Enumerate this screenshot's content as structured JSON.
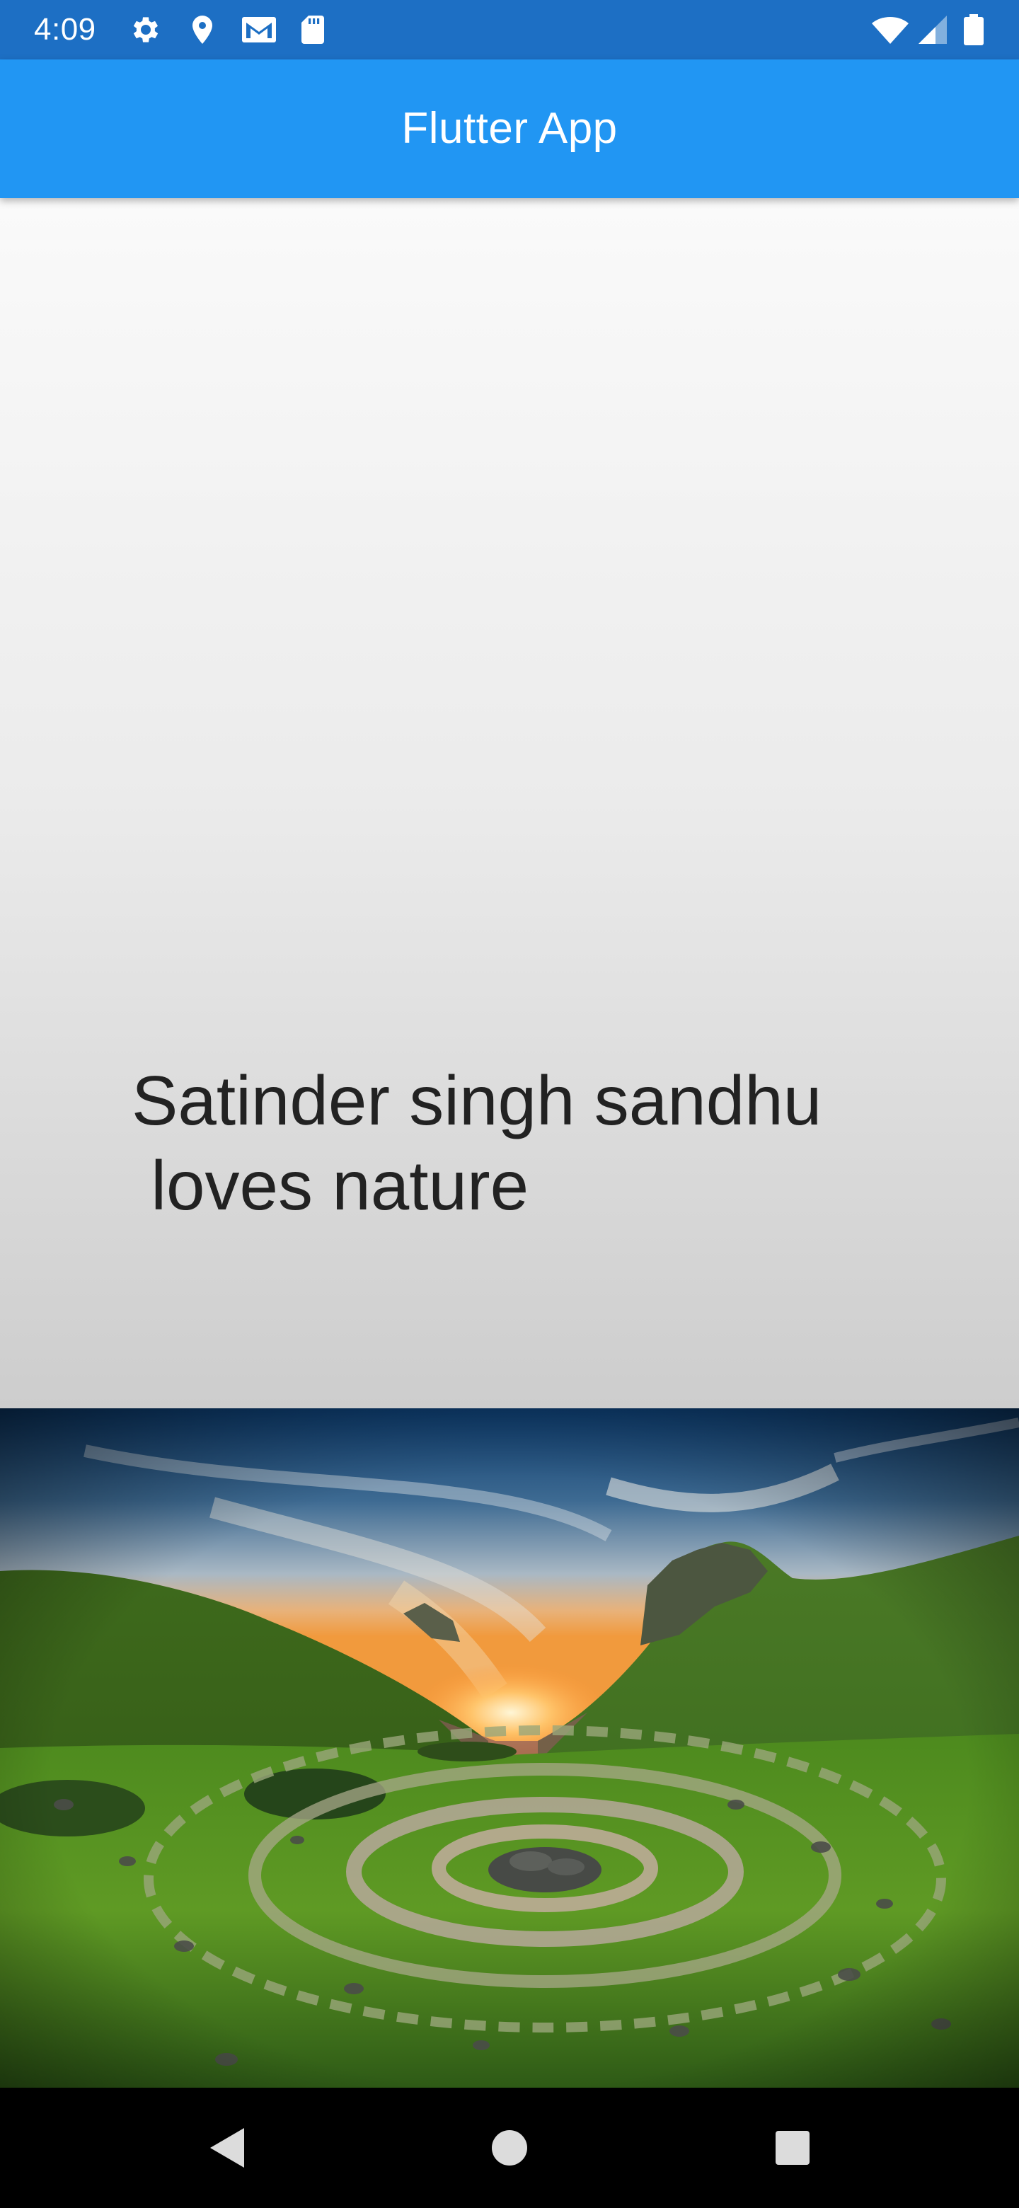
{
  "status_bar": {
    "time": "4:09",
    "left_icons": [
      "gear-icon",
      "location-pin-icon",
      "gmail-icon",
      "sd-card-icon"
    ],
    "right_icons": [
      "wifi-icon",
      "cellular-signal-icon",
      "battery-icon"
    ]
  },
  "app_bar": {
    "title": "Flutter App",
    "color": "#2196f3"
  },
  "content": {
    "headline": "Satinder singh sandhu\n loves nature",
    "background_gradient": [
      "#fafafa",
      "#cdcdcd"
    ]
  },
  "image": {
    "subject": "nature-landscape"
  },
  "nav_bar": {
    "buttons": [
      "back-icon",
      "home-icon",
      "recents-icon"
    ]
  }
}
